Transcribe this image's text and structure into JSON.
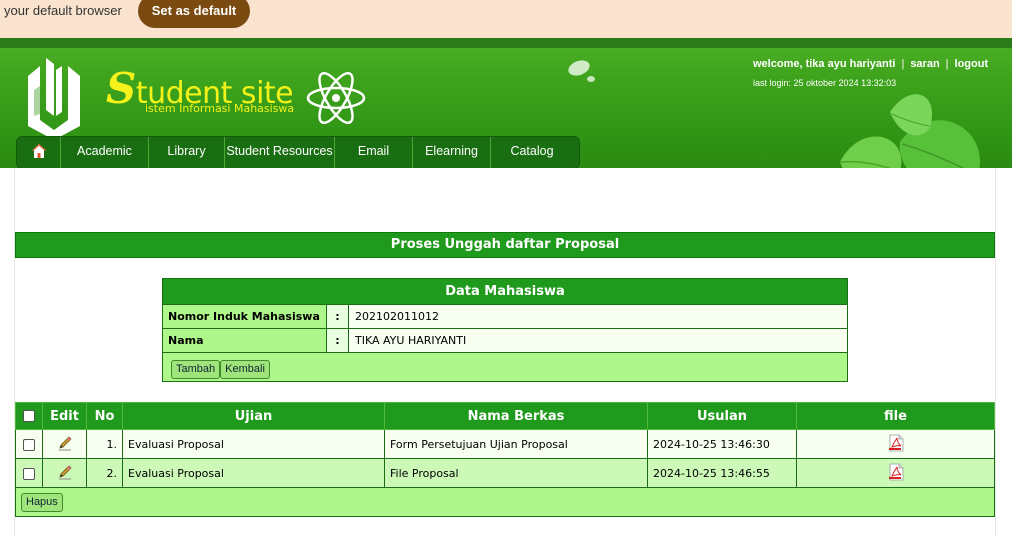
{
  "notice": {
    "text": "your default browser",
    "button": "Set as default"
  },
  "site": {
    "title_big": "S",
    "title_rest": "tudent site",
    "subtitle": "istem Informasi Mahasiswa"
  },
  "user": {
    "welcome": "welcome, tika ayu hariyanti",
    "sep": "|",
    "saran": "saran",
    "logout": "logout",
    "last_login": "last login: 25 oktober 2024 13:32:03"
  },
  "nav": {
    "items": [
      {
        "label": "Academic"
      },
      {
        "label": "Library"
      },
      {
        "label": "Student Resources"
      },
      {
        "label": "Email"
      },
      {
        "label": "Elearning"
      },
      {
        "label": "Catalog"
      }
    ]
  },
  "page": {
    "title": "Proses Unggah daftar Proposal"
  },
  "mahasiswa": {
    "heading": "Data Mahasiswa",
    "nim_label": "Nomor Induk Mahasiswa",
    "nim_value": "202102011012",
    "nama_label": "Nama",
    "nama_value": "TIKA AYU HARIYANTI",
    "colon": ":",
    "btn_tambah": "Tambah",
    "btn_kembali": "Kembali"
  },
  "table": {
    "headers": {
      "edit": "Edit",
      "no": "No",
      "ujian": "Ujian",
      "nama_berkas": "Nama Berkas",
      "usulan": "Usulan",
      "file": "file"
    },
    "rows": [
      {
        "no": "1.",
        "ujian": "Evaluasi Proposal",
        "nama_berkas": "Form Persetujuan Ujian Proposal",
        "usulan": "2024-10-25 13:46:30"
      },
      {
        "no": "2.",
        "ujian": "Evaluasi Proposal",
        "nama_berkas": "File Proposal",
        "usulan": "2024-10-25 13:46:55"
      }
    ],
    "btn_hapus": "Hapus"
  },
  "icons": {
    "home": "home-icon",
    "edit": "pencil-icon",
    "file": "pdf-icon",
    "logo": "logo-mark",
    "atom": "atom-logo",
    "leaf": "leaf-decoration"
  },
  "colors": {
    "header_green": "#3ea31c",
    "table_head": "#1f9a1c",
    "panel": "#aef78a",
    "logo_text": "#f2f218",
    "notice_bg": "#fbe4cf",
    "notice_btn": "#7a4a10"
  }
}
